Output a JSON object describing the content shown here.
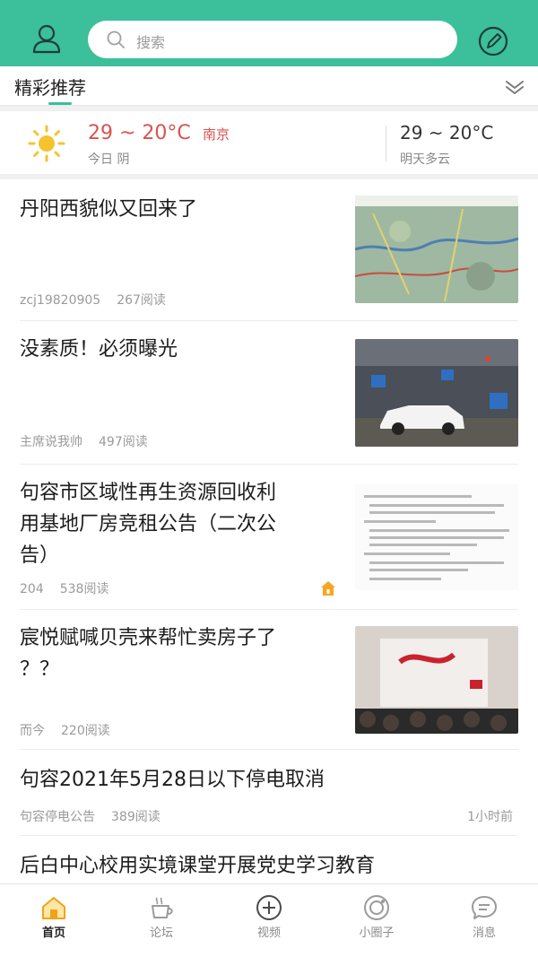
{
  "header": {
    "search_placeholder": "搜索",
    "user_icon": "user-icon",
    "compose_icon": "edit-icon",
    "accent_color": "#3cbf9b"
  },
  "tabs": {
    "active_label": "精彩推荐",
    "expand_icon": "chevron-down-icon"
  },
  "weather": {
    "today_temp": "29 ~ 20°C",
    "city": "南京",
    "today_condition": "今日 阴",
    "tomorrow_temp": "29 ~ 20°C",
    "tomorrow_condition": "明天多云",
    "icon": "sun-icon"
  },
  "feed": [
    {
      "title_lines": [
        "丹阳西貌似又回来了"
      ],
      "author": "zcj19820905",
      "reads": "267阅读",
      "thumb": "map-image"
    },
    {
      "title_lines": [
        "没素质！必须曝光"
      ],
      "author": "主席说我帅",
      "reads": "497阅读",
      "thumb": "parking-garage-image"
    },
    {
      "title_lines": [
        "句容市区域性再生资源回收利",
        "用基地厂房竞租公告（二次公",
        "告）"
      ],
      "author": "204",
      "reads": "538阅读",
      "thumb": "document-image",
      "badge": "hot-icon"
    },
    {
      "title_lines": [
        "宸悦赋喊贝壳来帮忙卖房子了",
        "？？"
      ],
      "author": "而今",
      "reads": "220阅读",
      "thumb": "presentation-image"
    },
    {
      "title_lines": [
        "句容2021年5月28日以下停电取消"
      ],
      "author": "句容停电公告",
      "reads": "389阅读",
      "time": "1小时前"
    },
    {
      "title_lines": [
        "后白中心校用实境课堂开展党史学习教育"
      ]
    }
  ],
  "bottom_nav": [
    {
      "label": "首页",
      "icon": "home-icon",
      "active": true
    },
    {
      "label": "论坛",
      "icon": "coffee-cup-icon",
      "active": false
    },
    {
      "label": "视频",
      "icon": "plus-circle-icon",
      "active": false
    },
    {
      "label": "小圈子",
      "icon": "circle-icon",
      "active": false
    },
    {
      "label": "消息",
      "icon": "message-icon",
      "active": false
    }
  ]
}
